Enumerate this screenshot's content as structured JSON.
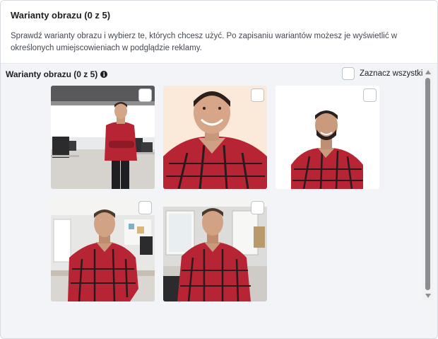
{
  "header": {
    "title": "Warianty obrazu (0 z 5)",
    "description": "Sprawdź warianty obrazu i wybierz te, których chcesz użyć. Po zapisaniu wariantów możesz je wyświetlić w określonych umiejscowieniach w podglądzie reklamy."
  },
  "section": {
    "title": "Warianty obrazu (0 z 5)",
    "info_icon": "info-icon"
  },
  "select_all": {
    "label": "Zaznacz wszystkie",
    "checked": false
  },
  "variants": [
    {
      "scene": "man-in-plaid-shirt-arms-crossed-office",
      "selected": false
    },
    {
      "scene": "man-in-plaid-shirt-smiling-closeup",
      "selected": false
    },
    {
      "scene": "man-in-plaid-shirt-white-background",
      "selected": false
    },
    {
      "scene": "man-in-plaid-shirt-leaning-desk",
      "selected": false
    },
    {
      "scene": "man-in-plaid-shirt-office-window",
      "selected": false
    }
  ],
  "colors": {
    "shirt_red": "#b72535",
    "shirt_dark": "#2a1a1e",
    "panel_bg": "#f2f4f7"
  }
}
